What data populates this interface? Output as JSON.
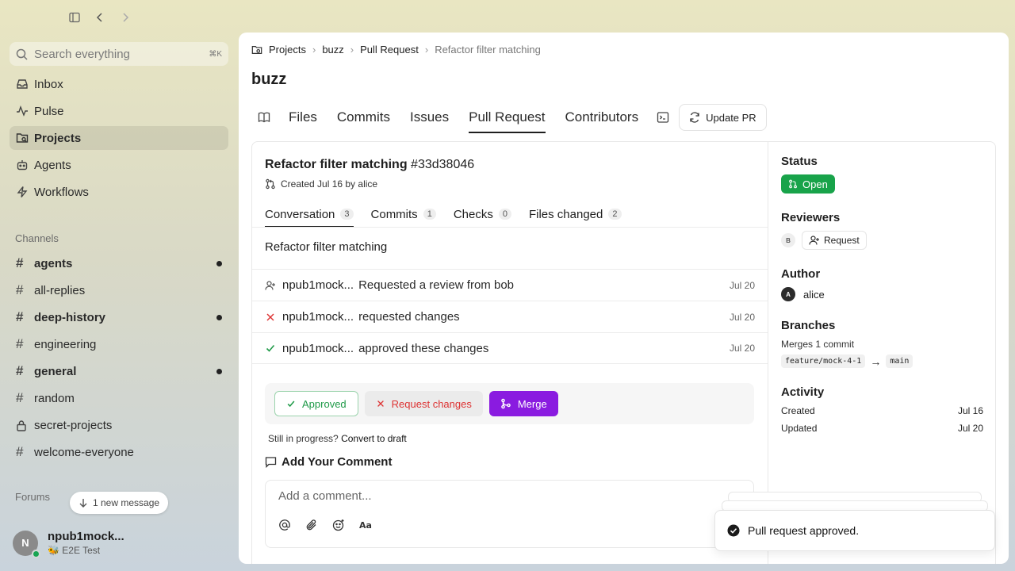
{
  "sidebar": {
    "search_placeholder": "Search everything",
    "search_shortcut": "⌘K",
    "nav": [
      {
        "label": "Inbox",
        "icon": "inbox-icon"
      },
      {
        "label": "Pulse",
        "icon": "pulse-icon"
      },
      {
        "label": "Projects",
        "icon": "projects-icon",
        "active": true
      },
      {
        "label": "Agents",
        "icon": "agents-icon"
      },
      {
        "label": "Workflows",
        "icon": "workflows-icon"
      }
    ],
    "channels_label": "Channels",
    "channels": [
      {
        "label": "agents",
        "unread": true,
        "icon": "hash"
      },
      {
        "label": "all-replies",
        "unread": false,
        "icon": "hash"
      },
      {
        "label": "deep-history",
        "unread": true,
        "icon": "hash"
      },
      {
        "label": "engineering",
        "unread": false,
        "icon": "hash"
      },
      {
        "label": "general",
        "unread": true,
        "icon": "hash"
      },
      {
        "label": "random",
        "unread": false,
        "icon": "hash"
      },
      {
        "label": "secret-projects",
        "unread": false,
        "icon": "lock"
      },
      {
        "label": "welcome-everyone",
        "unread": false,
        "icon": "hash"
      }
    ],
    "forums_label": "Forums",
    "new_message_label": "1 new message",
    "user": {
      "initial": "N",
      "name": "npub1mock...",
      "status": "🐝 E2E Test"
    }
  },
  "breadcrumb": [
    "Projects",
    "buzz",
    "Pull Request",
    "Refactor filter matching"
  ],
  "page_title": "buzz",
  "tabs": {
    "items": [
      "Files",
      "Commits",
      "Issues",
      "Pull Request",
      "Contributors"
    ],
    "active": "Pull Request",
    "update_label": "Update PR"
  },
  "pr": {
    "title": "Refactor filter matching",
    "id": "#33d38046",
    "meta": "Created Jul 16 by alice",
    "subtabs": [
      {
        "label": "Conversation",
        "count": "3",
        "active": true
      },
      {
        "label": "Commits",
        "count": "1"
      },
      {
        "label": "Checks",
        "count": "0"
      },
      {
        "label": "Files changed",
        "count": "2"
      }
    ],
    "description": "Refactor filter matching",
    "events": [
      {
        "icon": "add-user-icon",
        "who": "npub1mock...",
        "action": "Requested a review from bob",
        "date": "Jul 20"
      },
      {
        "icon": "x-icon",
        "who": "npub1mock...",
        "action": "requested changes",
        "date": "Jul 20"
      },
      {
        "icon": "check-icon",
        "who": "npub1mock...",
        "action": "approved these changes",
        "date": "Jul 20"
      }
    ],
    "buttons": {
      "approved": "Approved",
      "request_changes": "Request changes",
      "merge": "Merge"
    },
    "draft_prefix": "Still in progress?",
    "draft_link": "Convert to draft",
    "add_comment_label": "Add Your Comment",
    "comment_placeholder": "Add a comment..."
  },
  "details": {
    "status_label": "Status",
    "status_value": "Open",
    "reviewers_label": "Reviewers",
    "reviewer_initial": "B",
    "request_label": "Request",
    "author_label": "Author",
    "author_initial": "A",
    "author_name": "alice",
    "branches_label": "Branches",
    "merges_text": "Merges 1 commit",
    "from_branch": "feature/mock-4-1",
    "arrow": "→",
    "to_branch": "main",
    "activity_label": "Activity",
    "created_label": "Created",
    "created_value": "Jul 16",
    "updated_label": "Updated",
    "updated_value": "Jul 20"
  },
  "toast": {
    "message": "Pull request approved."
  },
  "colors": {
    "merge": "#8a1be0",
    "open": "#18a34a",
    "approved": "#1f9a48",
    "danger": "#dd3333"
  }
}
